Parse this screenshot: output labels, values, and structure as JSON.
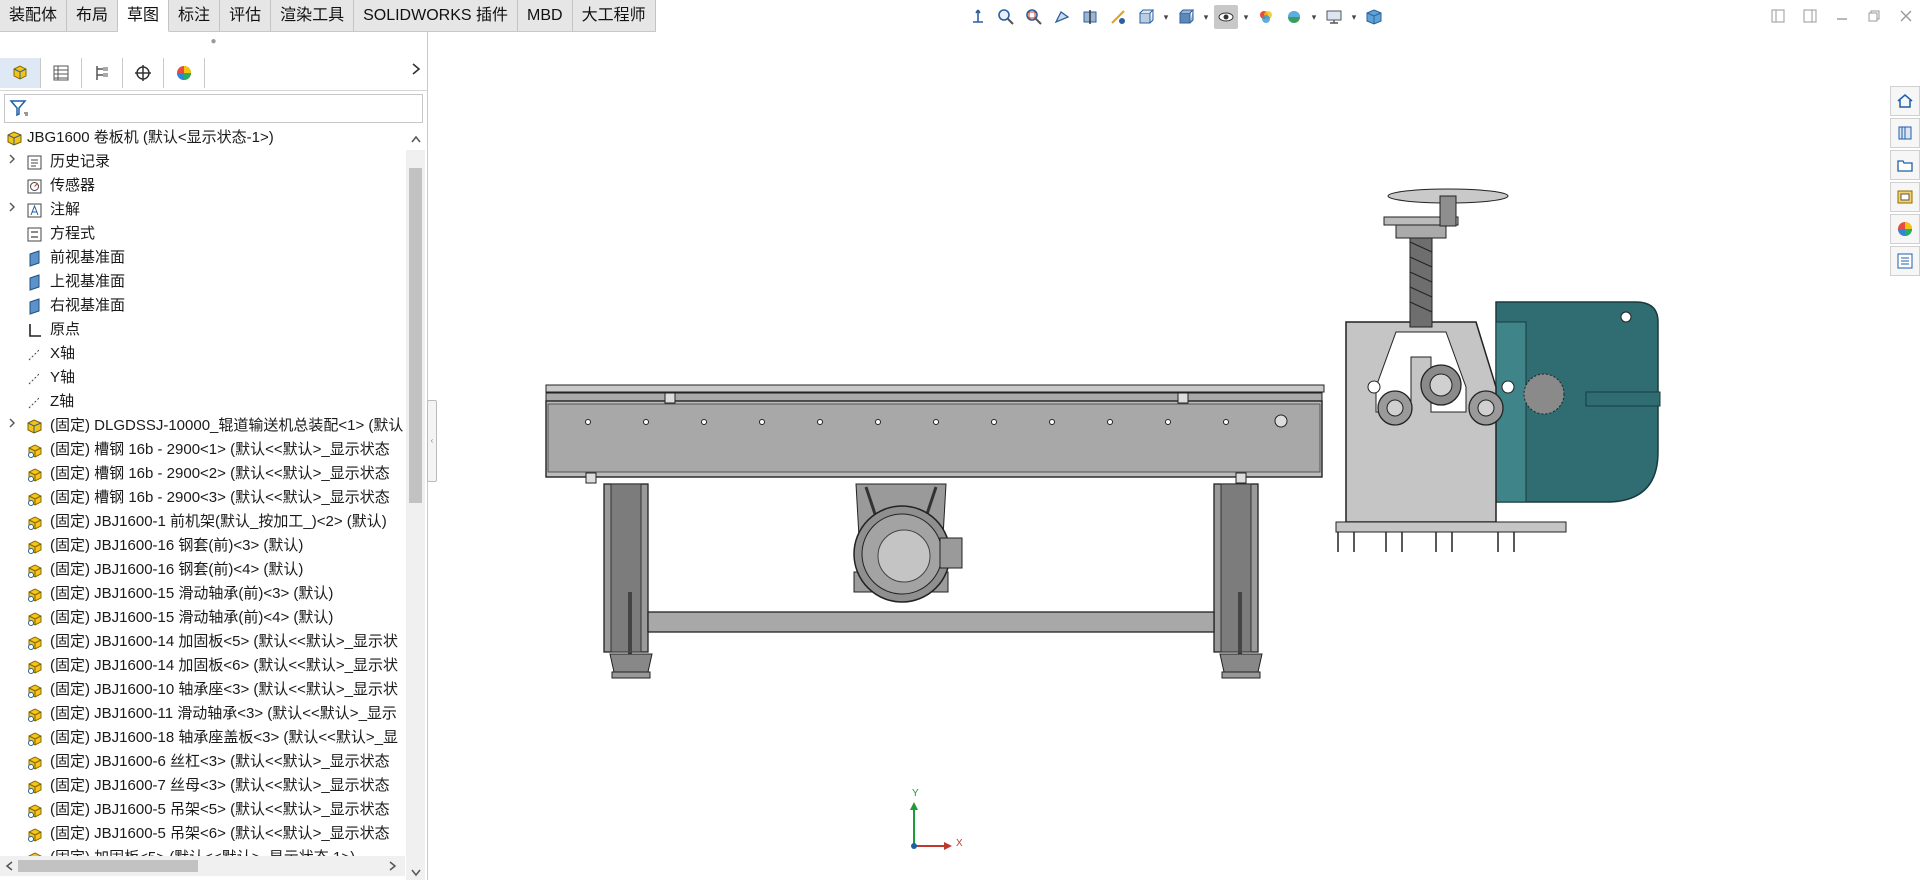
{
  "command_tabs": [
    {
      "label": "装配体"
    },
    {
      "label": "布局"
    },
    {
      "label": "草图"
    },
    {
      "label": "标注"
    },
    {
      "label": "评估"
    },
    {
      "label": "渲染工具"
    },
    {
      "label": "SOLIDWORKS 插件"
    },
    {
      "label": "MBD"
    },
    {
      "label": "大工程师"
    }
  ],
  "active_tab": "草图",
  "hud_icons": [
    "origin-icon",
    "zoom-to-fit-icon",
    "zoom-area-icon",
    "previous-view-icon",
    "section-view-icon",
    "dynamic-annotation-icon",
    "view-orientation-icon",
    "display-style-icon",
    "hide-show-icon",
    "edit-appearance-icon",
    "apply-scene-icon",
    "view-settings-icon",
    "3d-view-icon"
  ],
  "panel": {
    "tabs": [
      "featuremanager-tab",
      "propertymanager-tab",
      "configurationmanager-tab",
      "dimxpert-tab",
      "display-manager-tab"
    ],
    "filter_placeholder": ""
  },
  "tree": {
    "root": "JBG1600 卷板机  (默认<显示状态-1>)",
    "items": [
      {
        "label": "历史记录",
        "icon": "history-icon",
        "expandable": true
      },
      {
        "label": "传感器",
        "icon": "sensor-icon",
        "expandable": false
      },
      {
        "label": "注解",
        "icon": "annotation-icon",
        "expandable": true
      },
      {
        "label": "方程式",
        "icon": "equation-icon",
        "expandable": false
      },
      {
        "label": "前视基准面",
        "icon": "plane-icon",
        "expandable": false
      },
      {
        "label": "上视基准面",
        "icon": "plane-icon",
        "expandable": false
      },
      {
        "label": "右视基准面",
        "icon": "plane-icon",
        "expandable": false
      },
      {
        "label": "原点",
        "icon": "origin-icon",
        "expandable": false
      },
      {
        "label": "X轴",
        "icon": "axis-icon",
        "expandable": false
      },
      {
        "label": "Y轴",
        "icon": "axis-icon",
        "expandable": false
      },
      {
        "label": "Z轴",
        "icon": "axis-icon",
        "expandable": false
      },
      {
        "label": "(固定) DLGDSSJ-10000_辊道输送机总装配<1> (默认",
        "icon": "assembly-icon",
        "expandable": true
      },
      {
        "label": "(固定) 槽钢 16b - 2900<1> (默认<<默认>_显示状态",
        "icon": "part-icon",
        "expandable": false
      },
      {
        "label": "(固定) 槽钢 16b - 2900<2> (默认<<默认>_显示状态",
        "icon": "part-icon",
        "expandable": false
      },
      {
        "label": "(固定) 槽钢 16b - 2900<3> (默认<<默认>_显示状态",
        "icon": "part-icon",
        "expandable": false
      },
      {
        "label": "(固定) JBJ1600-1 前机架(默认_按加工_)<2> (默认)",
        "icon": "part-icon",
        "expandable": false
      },
      {
        "label": "(固定) JBJ1600-16 钢套(前)<3> (默认)",
        "icon": "part-icon",
        "expandable": false
      },
      {
        "label": "(固定) JBJ1600-16 钢套(前)<4> (默认)",
        "icon": "part-icon",
        "expandable": false
      },
      {
        "label": "(固定) JBJ1600-15 滑动轴承(前)<3> (默认)",
        "icon": "part-icon",
        "expandable": false
      },
      {
        "label": "(固定) JBJ1600-15 滑动轴承(前)<4> (默认)",
        "icon": "part-icon",
        "expandable": false
      },
      {
        "label": "(固定) JBJ1600-14 加固板<5> (默认<<默认>_显示状",
        "icon": "part-icon",
        "expandable": false
      },
      {
        "label": "(固定) JBJ1600-14 加固板<6> (默认<<默认>_显示状",
        "icon": "part-icon",
        "expandable": false
      },
      {
        "label": "(固定) JBJ1600-10 轴承座<3> (默认<<默认>_显示状",
        "icon": "part-icon",
        "expandable": false
      },
      {
        "label": "(固定) JBJ1600-11 滑动轴承<3> (默认<<默认>_显示",
        "icon": "part-icon",
        "expandable": false
      },
      {
        "label": "(固定) JBJ1600-18 轴承座盖板<3> (默认<<默认>_显",
        "icon": "part-icon",
        "expandable": false
      },
      {
        "label": "(固定) JBJ1600-6 丝杠<3> (默认<<默认>_显示状态",
        "icon": "part-icon",
        "expandable": false
      },
      {
        "label": "(固定) JBJ1600-7 丝母<3> (默认<<默认>_显示状态",
        "icon": "part-icon",
        "expandable": false
      },
      {
        "label": "(固定) JBJ1600-5 吊架<5> (默认<<默认>_显示状态",
        "icon": "part-icon",
        "expandable": false
      },
      {
        "label": "(固定) JBJ1600-5 吊架<6> (默认<<默认>_显示状态",
        "icon": "part-icon",
        "expandable": false
      },
      {
        "label": "(固定) 加固板<5> (默认<<默认>_显示状态 1>)",
        "icon": "part-icon",
        "expandable": false
      }
    ]
  },
  "triad": {
    "x_label": "X",
    "y_label": "Y"
  },
  "taskpane_icons": [
    "home-icon",
    "design-library-icon",
    "file-explorer-icon",
    "view-palette-icon",
    "appearances-icon",
    "custom-properties-icon"
  ]
}
